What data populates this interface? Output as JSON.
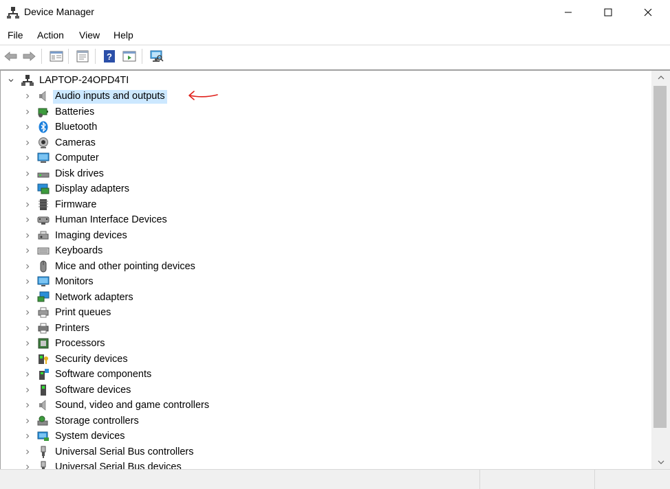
{
  "window": {
    "title": "Device Manager",
    "app_icon": "device-manager-icon"
  },
  "menu": [
    {
      "label": "File"
    },
    {
      "label": "Action"
    },
    {
      "label": "View"
    },
    {
      "label": "Help"
    }
  ],
  "toolbar": {
    "buttons": [
      "back-arrow-icon",
      "forward-arrow-icon",
      "show-hide-console-tree-icon",
      "properties-icon",
      "help-icon",
      "action-pane-icon",
      "scan-hardware-icon"
    ]
  },
  "tree": {
    "root": "LAPTOP-24OPD4TI",
    "categories": [
      {
        "label": "Audio inputs and outputs",
        "icon": "speaker-icon",
        "selected": true
      },
      {
        "label": "Batteries",
        "icon": "battery-icon"
      },
      {
        "label": "Bluetooth",
        "icon": "bluetooth-icon"
      },
      {
        "label": "Cameras",
        "icon": "camera-icon"
      },
      {
        "label": "Computer",
        "icon": "computer-icon"
      },
      {
        "label": "Disk drives",
        "icon": "disk-drive-icon"
      },
      {
        "label": "Display adapters",
        "icon": "display-adapter-icon"
      },
      {
        "label": "Firmware",
        "icon": "firmware-icon"
      },
      {
        "label": "Human Interface Devices",
        "icon": "hid-icon"
      },
      {
        "label": "Imaging devices",
        "icon": "imaging-icon"
      },
      {
        "label": "Keyboards",
        "icon": "keyboard-icon"
      },
      {
        "label": "Mice and other pointing devices",
        "icon": "mouse-icon"
      },
      {
        "label": "Monitors",
        "icon": "monitor-icon"
      },
      {
        "label": "Network adapters",
        "icon": "network-adapter-icon"
      },
      {
        "label": "Print queues",
        "icon": "print-queue-icon"
      },
      {
        "label": "Printers",
        "icon": "printer-icon"
      },
      {
        "label": "Processors",
        "icon": "processor-icon"
      },
      {
        "label": "Security devices",
        "icon": "security-device-icon"
      },
      {
        "label": "Software components",
        "icon": "software-component-icon"
      },
      {
        "label": "Software devices",
        "icon": "software-device-icon"
      },
      {
        "label": "Sound, video and game controllers",
        "icon": "sound-controller-icon"
      },
      {
        "label": "Storage controllers",
        "icon": "storage-controller-icon"
      },
      {
        "label": "System devices",
        "icon": "system-device-icon"
      },
      {
        "label": "Universal Serial Bus controllers",
        "icon": "usb-controller-icon"
      },
      {
        "label": "Universal Serial Bus devices",
        "icon": "usb-device-icon"
      }
    ]
  },
  "colors": {
    "selection": "#cce8ff",
    "annotation": "#e0201a"
  }
}
